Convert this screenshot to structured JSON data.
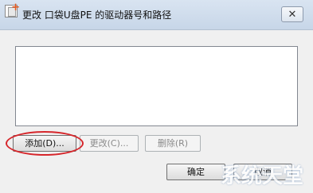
{
  "window": {
    "title": "更改 口袋U盘PE 的驱动器号和路径",
    "close_glyph": "✕"
  },
  "list": {
    "items": []
  },
  "buttons": {
    "add": "添加(D)...",
    "change": "更改(C)...",
    "remove": "删除(R)",
    "ok": "确定",
    "cancel": "取消"
  },
  "watermark": {
    "text": "系统天堂"
  },
  "colors": {
    "highlight_ring": "#d6262b",
    "title_bar": "#d9e4f1"
  }
}
